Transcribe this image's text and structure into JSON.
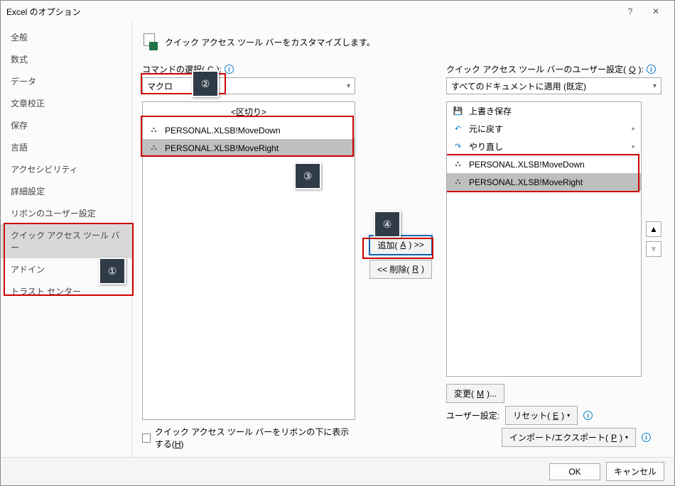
{
  "title": "Excel のオプション",
  "help_glyph": "?",
  "close_glyph": "✕",
  "sidebar": {
    "items": [
      {
        "label": "全般"
      },
      {
        "label": "数式"
      },
      {
        "label": "データ"
      },
      {
        "label": "文章校正"
      },
      {
        "label": "保存"
      },
      {
        "label": "言語"
      },
      {
        "label": "アクセシビリティ"
      },
      {
        "label": "詳細設定"
      },
      {
        "label": "リボンのユーザー設定"
      },
      {
        "label": "クイック アクセス ツール バー"
      },
      {
        "label": "アドイン"
      },
      {
        "label": "トラスト センター"
      }
    ],
    "selected_index": 9
  },
  "banner": "クイック アクセス ツール バーをカスタマイズします。",
  "left": {
    "label_pre": "コマンドの選択(",
    "label_u": "C",
    "label_post": "):",
    "dropdown_value": "マクロ",
    "separator_label": "<区切り>",
    "items": [
      {
        "label": "PERSONAL.XLSB!MoveDown"
      },
      {
        "label": "PERSONAL.XLSB!MoveRight"
      }
    ],
    "selected_index": 1
  },
  "right": {
    "label_pre": "クイック アクセス ツール バーのユーザー設定(",
    "label_u": "Q",
    "label_post": "):",
    "dropdown_value": "すべてのドキュメントに適用 (既定)",
    "items": [
      {
        "kind": "save",
        "label": "上書き保存"
      },
      {
        "kind": "undo",
        "label": "元に戻す",
        "arrow": true
      },
      {
        "kind": "redo",
        "label": "やり直し",
        "arrow": true
      },
      {
        "kind": "macro",
        "label": "PERSONAL.XLSB!MoveDown"
      },
      {
        "kind": "macro",
        "label": "PERSONAL.XLSB!MoveRight"
      }
    ],
    "selected_index": 4
  },
  "mid": {
    "add_pre": "追加(",
    "add_u": "A",
    "add_post": ") >>",
    "remove_pre": "<< 削除(",
    "remove_u": "R",
    "remove_post": ")"
  },
  "bottom": {
    "modify_pre": "変更(",
    "modify_u": "M",
    "modify_post": ")...",
    "user_label": "ユーザー設定:",
    "reset_pre": "リセット(",
    "reset_u": "E",
    "reset_post": ")",
    "importexport_pre": "インポート/エクスポート(",
    "importexport_u": "P",
    "importexport_post": ")",
    "show_below_pre": "クイック アクセス ツール バーをリボンの下に表示する(",
    "show_below_u": "H",
    "show_below_post": ")"
  },
  "footer": {
    "ok": "OK",
    "cancel": "キャンセル"
  },
  "callouts": {
    "1": "①",
    "2": "②",
    "3": "③",
    "4": "④"
  },
  "icons": {
    "save": "💾",
    "undo": "↶",
    "redo": "↷",
    "macro": "⛬",
    "chev_right": "▸",
    "up": "▲",
    "down": "▼",
    "info": "i",
    "dropdown_caret": "▾"
  }
}
